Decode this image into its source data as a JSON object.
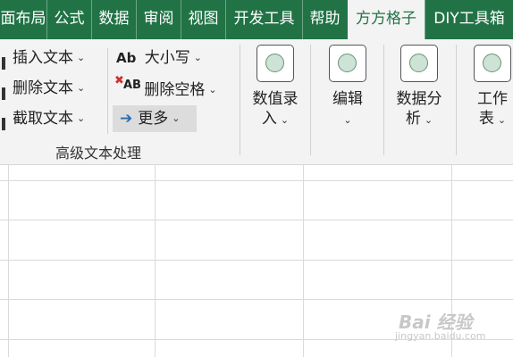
{
  "tabs": [
    {
      "label": "面布局",
      "active": false
    },
    {
      "label": "公式",
      "active": false
    },
    {
      "label": "数据",
      "active": false
    },
    {
      "label": "审阅",
      "active": false
    },
    {
      "label": "视图",
      "active": false
    },
    {
      "label": "开发工具",
      "active": false
    },
    {
      "label": "帮助",
      "active": false
    },
    {
      "label": "方方格子",
      "active": true
    },
    {
      "label": "DIY工具箱",
      "active": false
    }
  ],
  "ribbon": {
    "text_tools": {
      "insert_text": "插入文本",
      "delete_text": "删除文本",
      "extract_text": "截取文本",
      "case_icon_text": "Ab",
      "case": "大小写",
      "delete_spaces_icon_text": "AB",
      "delete_spaces": "删除空格",
      "more": "更多",
      "group_label": "高级文本处理"
    },
    "big_buttons": {
      "numeric_entry_line1": "数值录",
      "numeric_entry_line2": "入",
      "edit": "编辑",
      "data_analysis_line1": "数据分",
      "data_analysis_line2": "析",
      "worksheet_line1": "工作",
      "worksheet_line2": "表"
    }
  },
  "watermark": {
    "text": "Bai 经验",
    "sub": "jingyan.baidu.com"
  },
  "colors": {
    "tab_bar": "#217346",
    "ribbon_bg": "#f3f3f3",
    "highlight": "#dcdcdc"
  }
}
